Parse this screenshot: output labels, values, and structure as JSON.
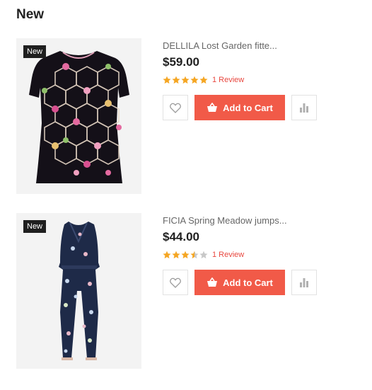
{
  "section": {
    "title": "New"
  },
  "products": [
    {
      "badge": "New",
      "name": "DELLILA Lost Garden fitte...",
      "price": "$59.00",
      "rating": 5,
      "reviews": "1 Review",
      "add_to_cart": "Add to Cart"
    },
    {
      "badge": "New",
      "name": "FICIA Spring Meadow jumps...",
      "price": "$44.00",
      "rating": 3.5,
      "reviews": "1 Review",
      "add_to_cart": "Add to Cart"
    }
  ],
  "colors": {
    "accent": "#f15a48",
    "star_filled": "#f5a623",
    "star_empty": "#c8c8c8",
    "badge_bg": "#1f1f1f"
  }
}
